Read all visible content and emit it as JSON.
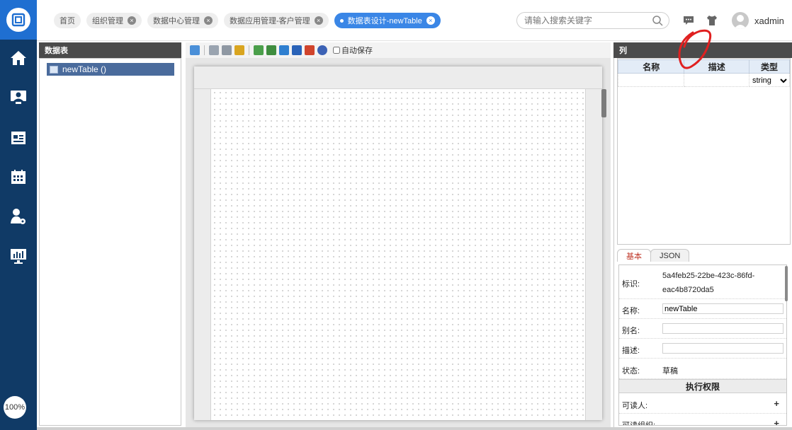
{
  "app": {
    "zoom": "100%"
  },
  "tabs": [
    {
      "label": "首页",
      "closable": false,
      "active": false
    },
    {
      "label": "组织管理",
      "closable": true,
      "active": false
    },
    {
      "label": "数据中心管理",
      "closable": true,
      "active": false
    },
    {
      "label": "数据应用管理-客户管理",
      "closable": true,
      "active": false
    },
    {
      "label": "数据表设计-newTable",
      "closable": true,
      "active": true
    }
  ],
  "search": {
    "placeholder": "请输入搜索关键字"
  },
  "user": {
    "name": "xadmin"
  },
  "rail": {
    "items": [
      "home-icon",
      "contacts-icon",
      "calendar-list-icon",
      "calendar-icon",
      "user-settings-icon",
      "dashboard-icon"
    ]
  },
  "tree": {
    "title": "数据表",
    "items": [
      {
        "label": "newTable ()"
      }
    ]
  },
  "toolbar": {
    "autosave_label": "自动保存"
  },
  "columns": {
    "title": "列",
    "headers": [
      "名称",
      "描述",
      "类型"
    ],
    "rows": [
      {
        "name": "",
        "desc": "",
        "type": "string"
      }
    ]
  },
  "props": {
    "tabs": [
      "基本",
      "JSON"
    ],
    "id_label": "标识:",
    "id_value_line1": "5a4feb25-22be-423c-86fd-",
    "id_value_line2": "eac4b8720da5",
    "name_label": "名称:",
    "name_value": "newTable",
    "alias_label": "别名:",
    "alias_value": "",
    "desc_label": "描述:",
    "desc_value": "",
    "status_label": "状态:",
    "status_value": "草稿",
    "exec_title": "执行权限",
    "readers_label": "可读人:",
    "readers_org_label": "可读组织:"
  },
  "colors": {
    "rail": "#103a66",
    "logo_bg": "#1f6fd1",
    "active_tab": "#3a86e6",
    "panel_head": "#4b4b4b",
    "annotation": "#e02020"
  }
}
